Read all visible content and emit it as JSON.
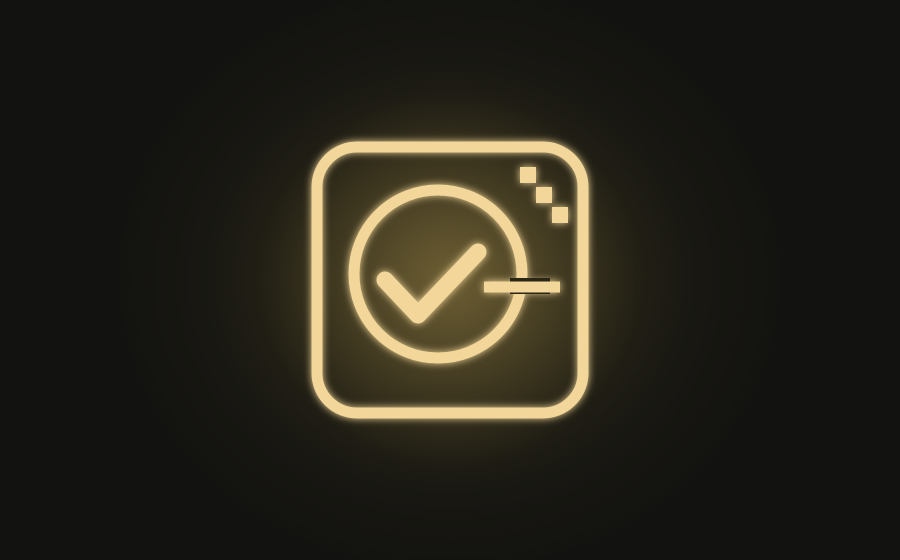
{
  "icon": {
    "name": "task-complete-app-icon",
    "accent_color": "#f3d79a",
    "background_color": "#121210",
    "glow_color": "#c8aa5a"
  }
}
